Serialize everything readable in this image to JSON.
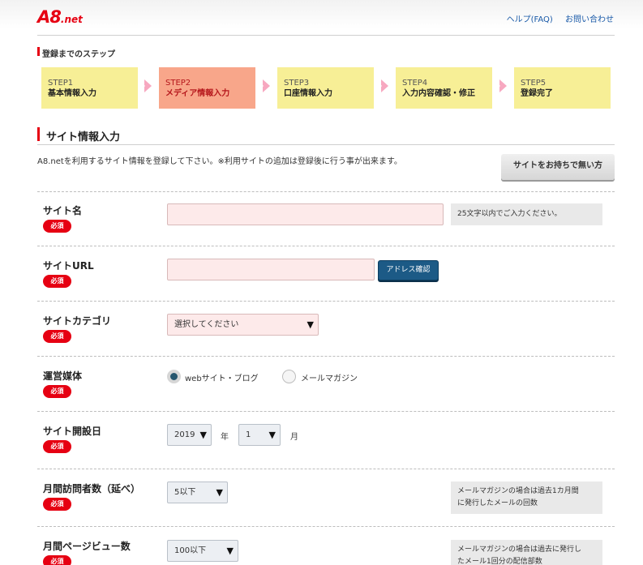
{
  "header": {
    "logo_main": "A8",
    "logo_sub": "net",
    "help_link": "ヘルプ(FAQ)",
    "contact_link": "お問い合わせ"
  },
  "steps": {
    "title": "登録までのステップ",
    "items": [
      {
        "num": "STEP1",
        "name": "基本情報入力"
      },
      {
        "num": "STEP2",
        "name": "メディア情報入力"
      },
      {
        "num": "STEP3",
        "name": "口座情報入力"
      },
      {
        "num": "STEP4",
        "name": "入力内容確認・修正"
      },
      {
        "num": "STEP5",
        "name": "登録完了"
      }
    ],
    "active_index": 1
  },
  "section": {
    "title": "サイト情報入力",
    "intro": "A8.netを利用するサイト情報を登録して下さい。※利用サイトの追加は登録後に行う事が出来ます。",
    "nosite_button": "サイトをお持ちで無い方"
  },
  "required_label": "必須",
  "form": {
    "site_name": {
      "label": "サイト名",
      "value": "",
      "hint": "25文字以内でご入力ください。"
    },
    "site_url": {
      "label": "サイトURL",
      "value": "",
      "button": "アドレス確認"
    },
    "site_category": {
      "label": "サイトカテゴリ",
      "selected": "選択してください"
    },
    "media": {
      "label": "運営媒体",
      "options": [
        "webサイト・ブログ",
        "メールマガジン"
      ],
      "selected_index": 0
    },
    "open_date": {
      "label": "サイト開設日",
      "year": "2019",
      "year_unit": "年",
      "month": "1",
      "month_unit": "月"
    },
    "monthly_visitors": {
      "label": "月間訪問者数（延べ）",
      "selected": "5以下",
      "hint_line1": "メールマガジンの場合は過去1カ月間",
      "hint_line2": "に発行したメールの回数"
    },
    "monthly_pageviews": {
      "label": "月間ページビュー数",
      "selected": "100以下",
      "hint_line1": "メールマガジンの場合は過去に発行し",
      "hint_line2": "たメール1回分の配信部数"
    }
  },
  "icons": {
    "dropdown": "triangle-down-icon"
  },
  "colors": {
    "brand_red": "#e60012",
    "step_yellow": "#f7ef96",
    "step_active": "#f8a68a",
    "link_blue": "#1a5aa8",
    "button_blue": "#1c5a86"
  }
}
